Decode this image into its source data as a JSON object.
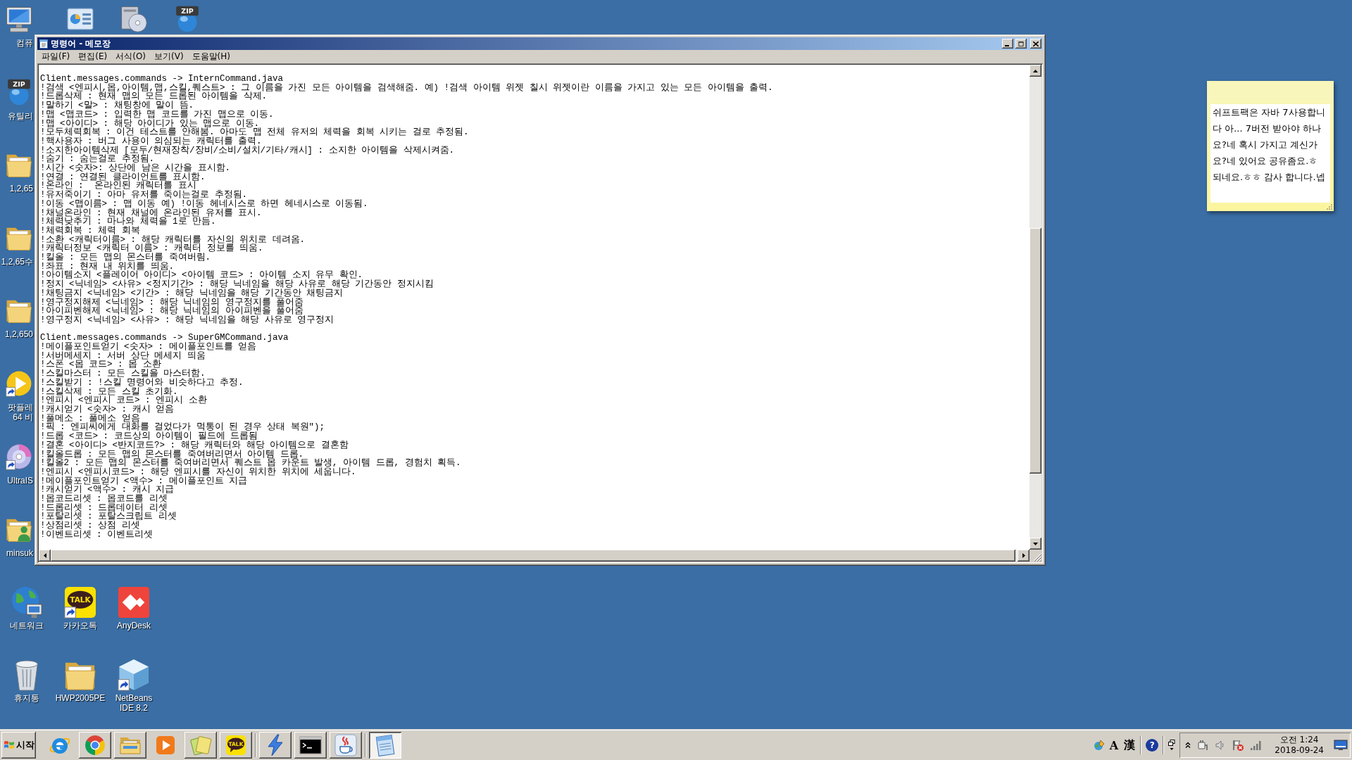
{
  "desktop": {
    "left_column": [
      {
        "kind": "computer",
        "shortcut": false,
        "lines": [
          "컴퓨"
        ]
      },
      {
        "kind": "zip",
        "badge": "ZIP",
        "shortcut": false,
        "lines": [
          "유틸리"
        ]
      },
      {
        "kind": "folder",
        "shortcut": false,
        "lines": [
          "1,2,65"
        ]
      },
      {
        "kind": "folder",
        "shortcut": false,
        "lines": [
          "1,2,65수"
        ]
      },
      {
        "kind": "folder",
        "shortcut": false,
        "lines": [
          "1,2,650"
        ]
      },
      {
        "kind": "player",
        "shortcut": true,
        "lines": [
          "팟플레",
          "64 비"
        ]
      },
      {
        "kind": "disc",
        "shortcut": true,
        "lines": [
          "UltraIS"
        ]
      },
      {
        "kind": "user-folder",
        "shortcut": false,
        "lines": [
          "minsuk"
        ]
      }
    ],
    "top_row": [
      {
        "kind": "chart-panel",
        "shortcut": false
      },
      {
        "kind": "disc-drive",
        "shortcut": false
      },
      {
        "kind": "zip",
        "badge": "ZIP",
        "shortcut": false
      }
    ],
    "bottom_rows": [
      [
        {
          "kind": "network",
          "shortcut": false,
          "lines": [
            "네트워크"
          ]
        },
        {
          "kind": "talk",
          "badge": "TALK",
          "shortcut": true,
          "lines": [
            "카카오톡"
          ]
        },
        {
          "kind": "anydesk",
          "shortcut": false,
          "lines": [
            "AnyDesk"
          ]
        }
      ],
      [
        {
          "kind": "recycle-bin",
          "shortcut": false,
          "lines": [
            "휴지통"
          ]
        },
        {
          "kind": "folder",
          "shortcut": false,
          "lines": [
            "HWP2005PE"
          ]
        },
        {
          "kind": "cube",
          "shortcut": true,
          "lines": [
            "NetBeans",
            "IDE 8.2"
          ]
        }
      ]
    ]
  },
  "notepad": {
    "title": "명령어 - 메모장",
    "menu": [
      "파일(F)",
      "편집(E)",
      "서식(O)",
      "보기(V)",
      "도움말(H)"
    ],
    "sections": [
      {
        "header": "Client.messages.commands -> InternCommand.java",
        "lines": [
          "!검색 <엔피시,몹,아이템,맵,스킬,퀘스트> : 그 이름을 가진 모든 아이템을 검색해줌. 예) !검색 아이템 위젯 칠시 위젯이란 이름을 가지고 있는 모든 아이템을 출력.",
          "!드롭삭제 : 현재 맵의 모든 드롭된 아이템을 삭제.",
          "!말하기 <말> : 채팅창에 말이 뜸.",
          "!맵 <맵코드> : 입력한 맵 코드를 가진 맵으로 이동.",
          "!맵 <아이디> : 해당 아이디가 있는 맵으로 이동.",
          "!모두체력회복 : 이건 테스트를 안해봄. 아마도 맵 전체 유저의 체력을 회복 시키는 걸로 추정됨.",
          "!핵사용자 : 버그 사용이 의심되는 캐릭터를 출력.",
          "!소지한아이템삭제 [모두/현재장착/장비/소비/설치/기타/캐시] : 소지한 아이템을 삭제시켜줌.",
          "!숨기 : 숨는걸로 추정됨.",
          "!시간 <숫자>: 상단에 남은 시간을 표시함.",
          "!연결 : 연결된 클라이언트를 표시함.",
          "!온라인 :  온라인된 캐릭터를 표시",
          "!유저죽이기 : 아마 유저를 죽이는걸로 추정됨.",
          "!이동 <맵이름> : 맵 이동 예) !이동 헤네시스로 하면 헤네시스로 이동됨.",
          "!채널온라인 : 현재 채널에 온라인된 유저를 표시.",
          "!체력낮추기 : 마나와 체력을 1로 만듬.",
          "!체력회복 : 체력 회복",
          "!소환 <캐릭터이름> : 해당 캐릭터를 자신의 위치로 데려옴.",
          "!캐릭터정보 <캐릭터 이름> : 캐릭터 정보를 띄움.",
          "!킬올 : 모든 맵의 몬스터를 죽여버림.",
          "!좌표 : 현재 내 위치를 띄움.",
          "!아이템소지 <플레이어 아이디> <아이템 코드> : 아이템 소지 유무 확인.",
          "!정지 <닉네임> <사유> <정지기간> : 해당 닉네임을 해당 사유로 해당 기간동안 정지시킴",
          "!채팅금지 <닉네임> <기간> : 해당 닉네임을 해당 기간동안 채팅금지",
          "!영구정지해제 <닉네임> : 해당 닉네임의 영구정지를 풀어줌",
          "!아이피벤해제 <닉네임> : 해당 닉네임의 아이피벤을 풀어줌",
          "!영구정지 <닉네임> <사유> : 해당 닉네임을 해당 사유로 영구정지"
        ]
      },
      {
        "header": "Client.messages.commands -> SuperGMCommand.java",
        "lines": [
          "!메이플포인트얻기 <숫자> : 메이플포인트를 얻음",
          "!서버메세지 : 서버 상단 메세지 띄움",
          "!스폰 <몹 코드> : 몹 소환",
          "!스킬마스터 : 모든 스킬을 마스터함.",
          "!스킬받기 : !스킬 명령어와 비슷하다고 추정.",
          "!스킬삭제 : 모든 스킬 초기화.",
          "!엔피시 <엔피시 코드> : 엔피시 소환",
          "!캐시얻기 <숫자> : 캐시 얻음",
          "!풀메소 : 풀메소 얻음",
          "!픽 : 엔피씨에게 대화를 걸었다가 먹통이 된 경우 상태 복원\");",
          "!드롭 <코드> : 코드상의 아이템이 필드에 드롭됨",
          "!결혼 <아이디> <반지코드?> : 해당 캐릭터와 해당 아이템으로 결혼함",
          "!킬올드롭 : 모든 맵의 몬스터를 죽여버리면서 아이템 드롭.",
          "!킬올2 : 모든 맵의 몬스터를 죽여버리면서 퀘스트 몹 카운트 발생, 아이템 드롭, 경험치 획득.",
          "!엔피시 <엔피시코드> : 해당 엔피시를 자신이 위치한 위치에 세웁니다.",
          "!메이플포인트얻기 <액수> : 메이플포인트 지급",
          "!캐시얻기 <액수> : 캐시 지급",
          "!몹코드리셋 : 몹코드를 리셋",
          "!드롭리셋 : 드롭데이터 리셋",
          "!포탈리셋 : 포탈스크립트 리셋",
          "!상점리셋 : 상점 리셋",
          "!이벤트리셋 : 이벤트리셋"
        ]
      }
    ]
  },
  "sticky_note": {
    "lines": [
      "쉬프트팩은 자바 7사용합니",
      "다 아... 7버전 받아야 하나",
      "요?네 혹시 가지고 계신가",
      "요?네 있어요 공유좀요.ㅎ",
      "되네요.ㅎㅎ 감사 합니다.넵"
    ]
  },
  "taskbar": {
    "start": {
      "label": "시작"
    },
    "groups": [
      [
        {
          "kind": "ie",
          "raised": false,
          "selected": false
        },
        {
          "kind": "chrome",
          "raised": true,
          "selected": false
        },
        {
          "kind": "explorer",
          "raised": true,
          "selected": false
        },
        {
          "kind": "media",
          "raised": false,
          "selected": false
        },
        {
          "kind": "cards",
          "raised": true,
          "selected": false
        },
        {
          "kind": "talk",
          "badge": "TALK",
          "raised": true,
          "selected": false
        }
      ],
      [
        {
          "kind": "bolt",
          "raised": true,
          "selected": false
        },
        {
          "kind": "cmd",
          "raised": true,
          "selected": false
        },
        {
          "kind": "java",
          "raised": true,
          "selected": false
        }
      ],
      [
        {
          "kind": "notepad",
          "raised": false,
          "selected": true
        }
      ]
    ],
    "language_bar": {
      "mode": "A",
      "hanja": "漢",
      "help": "?"
    },
    "tray_icons": [
      {
        "kind": "power"
      },
      {
        "kind": "speaker"
      },
      {
        "kind": "action-flag"
      },
      {
        "kind": "signal"
      }
    ],
    "clock": {
      "time": "오전 1:24",
      "date": "2018-09-24"
    }
  }
}
